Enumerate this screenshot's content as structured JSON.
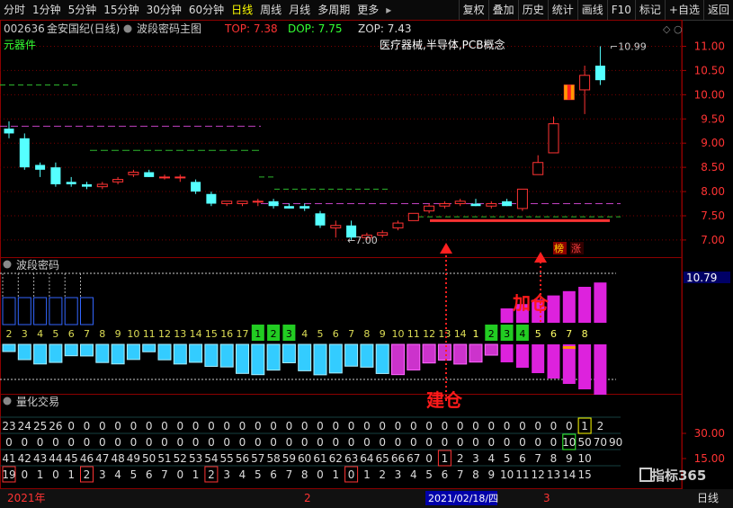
{
  "toolbar": {
    "left_items": [
      "分时",
      "1分钟",
      "5分钟",
      "15分钟",
      "30分钟",
      "60分钟",
      "日线",
      "周线",
      "月线",
      "多周期",
      "更多"
    ],
    "active_item": "日线",
    "right_items": [
      "复权",
      "叠加",
      "历史",
      "统计",
      "画线",
      "F10",
      "标记",
      "+自选",
      "返回"
    ]
  },
  "main_panel": {
    "stock_code": "002636",
    "stock_name": "金安国纪(日线)",
    "indicator_name": "波段密码主图",
    "top_label": "TOP: 7.38",
    "dop_label": "DOP: 7.75",
    "zop_label": "ZOP: 7.43",
    "sector": "元器件",
    "concepts": "医疗器械,半导体,PCB概念",
    "high_marker": "10.99",
    "low_marker": "7.00",
    "price_axis": [
      "11.00",
      "10.50",
      "10.00",
      "9.50",
      "9.00",
      "8.50",
      "8.00",
      "7.50",
      "7.00"
    ],
    "badges": [
      "榜",
      "涨"
    ]
  },
  "band_panel": {
    "title": "波段密码",
    "right_value": "10.79",
    "annotation_add": "加仓",
    "annotation_build": "建仓",
    "counters": [
      "2",
      "3",
      "4",
      "5",
      "6",
      "7",
      "8",
      "9",
      "10",
      "11",
      "12",
      "13",
      "14",
      "15",
      "16",
      "17",
      "1",
      "2",
      "3",
      "4",
      "5",
      "6",
      "7",
      "8",
      "9",
      "10",
      "11",
      "12",
      "13",
      "14",
      "1",
      "2",
      "3",
      "4",
      "5",
      "6",
      "7",
      "8"
    ]
  },
  "quant_panel": {
    "title": "量化交易",
    "axis": [
      "30.00",
      "15.00"
    ],
    "rows": [
      [
        "23",
        "24",
        "25",
        "26",
        "0",
        "0",
        "0",
        "0",
        "0",
        "0",
        "0",
        "0",
        "0",
        "0",
        "0",
        "0",
        "0",
        "0",
        "0",
        "0",
        "0",
        "0",
        "0",
        "0",
        "0",
        "0",
        "0",
        "0",
        "0",
        "0",
        "0",
        "0",
        "0",
        "0",
        "0",
        "0",
        "0",
        "1",
        "2"
      ],
      [
        "0",
        "0",
        "0",
        "0",
        "0",
        "0",
        "0",
        "0",
        "0",
        "0",
        "0",
        "0",
        "0",
        "0",
        "0",
        "0",
        "0",
        "0",
        "0",
        "0",
        "0",
        "0",
        "0",
        "0",
        "0",
        "0",
        "0",
        "0",
        "0",
        "0",
        "0",
        "0",
        "0",
        "0",
        "0",
        "0",
        "10",
        "50",
        "70",
        "90"
      ],
      [
        "41",
        "42",
        "43",
        "44",
        "45",
        "46",
        "47",
        "48",
        "49",
        "50",
        "51",
        "52",
        "53",
        "54",
        "55",
        "56",
        "57",
        "58",
        "59",
        "60",
        "61",
        "62",
        "63",
        "64",
        "65",
        "66",
        "67",
        "0",
        "1",
        "2",
        "3",
        "4",
        "5",
        "6",
        "7",
        "8",
        "9",
        "10"
      ],
      [
        "19",
        "0",
        "1",
        "0",
        "1",
        "2",
        "3",
        "4",
        "5",
        "6",
        "7",
        "0",
        "1",
        "2",
        "3",
        "4",
        "5",
        "6",
        "7",
        "8",
        "0",
        "1",
        "0",
        "1",
        "2",
        "3",
        "4",
        "5",
        "6",
        "7",
        "8",
        "9",
        "10",
        "11",
        "12",
        "13",
        "14",
        "15"
      ]
    ]
  },
  "bottom_bar": {
    "year": "2021年",
    "month2": "2",
    "date_highlight": "2021/02/18/四",
    "month3": "3",
    "period": "日线"
  },
  "branding": "指标365",
  "chart_data": {
    "type": "candlestick",
    "ohlc": [
      [
        9.3,
        9.45,
        9.1,
        9.2
      ],
      [
        9.1,
        9.2,
        8.45,
        8.5
      ],
      [
        8.55,
        8.6,
        8.3,
        8.45
      ],
      [
        8.5,
        8.6,
        8.1,
        8.15
      ],
      [
        8.2,
        8.3,
        8.1,
        8.15
      ],
      [
        8.15,
        8.2,
        8.05,
        8.1
      ],
      [
        8.1,
        8.2,
        8.05,
        8.15
      ],
      [
        8.2,
        8.3,
        8.15,
        8.25
      ],
      [
        8.35,
        8.45,
        8.3,
        8.4
      ],
      [
        8.4,
        8.45,
        8.3,
        8.3
      ],
      [
        8.3,
        8.35,
        8.25,
        8.3
      ],
      [
        8.3,
        8.35,
        8.2,
        8.3
      ],
      [
        8.2,
        8.25,
        7.95,
        8.0
      ],
      [
        7.95,
        8.0,
        7.7,
        7.75
      ],
      [
        7.75,
        7.8,
        7.7,
        7.8
      ],
      [
        7.75,
        7.8,
        7.7,
        7.8
      ],
      [
        7.8,
        7.85,
        7.7,
        7.8
      ],
      [
        7.8,
        7.85,
        7.65,
        7.7
      ],
      [
        7.7,
        7.75,
        7.65,
        7.65
      ],
      [
        7.7,
        7.75,
        7.6,
        7.65
      ],
      [
        7.55,
        7.6,
        7.25,
        7.3
      ],
      [
        7.25,
        7.4,
        7.05,
        7.3
      ],
      [
        7.3,
        7.4,
        7.0,
        7.05
      ],
      [
        7.05,
        7.15,
        7.0,
        7.1
      ],
      [
        7.1,
        7.2,
        7.05,
        7.15
      ],
      [
        7.25,
        7.4,
        7.2,
        7.35
      ],
      [
        7.4,
        7.55,
        7.4,
        7.55
      ],
      [
        7.6,
        7.75,
        7.55,
        7.7
      ],
      [
        7.7,
        7.8,
        7.65,
        7.75
      ],
      [
        7.75,
        7.85,
        7.7,
        7.8
      ],
      [
        7.75,
        7.85,
        7.7,
        7.7
      ],
      [
        7.7,
        7.8,
        7.65,
        7.75
      ],
      [
        7.8,
        7.85,
        7.7,
        7.7
      ],
      [
        7.65,
        8.05,
        7.6,
        8.05
      ],
      [
        8.35,
        8.75,
        8.35,
        8.6
      ],
      [
        8.8,
        9.55,
        8.8,
        9.4
      ],
      [
        9.9,
        10.2,
        9.9,
        10.2
      ],
      [
        10.1,
        10.6,
        9.6,
        10.4
      ],
      [
        10.6,
        11.0,
        10.2,
        10.3
      ]
    ]
  }
}
